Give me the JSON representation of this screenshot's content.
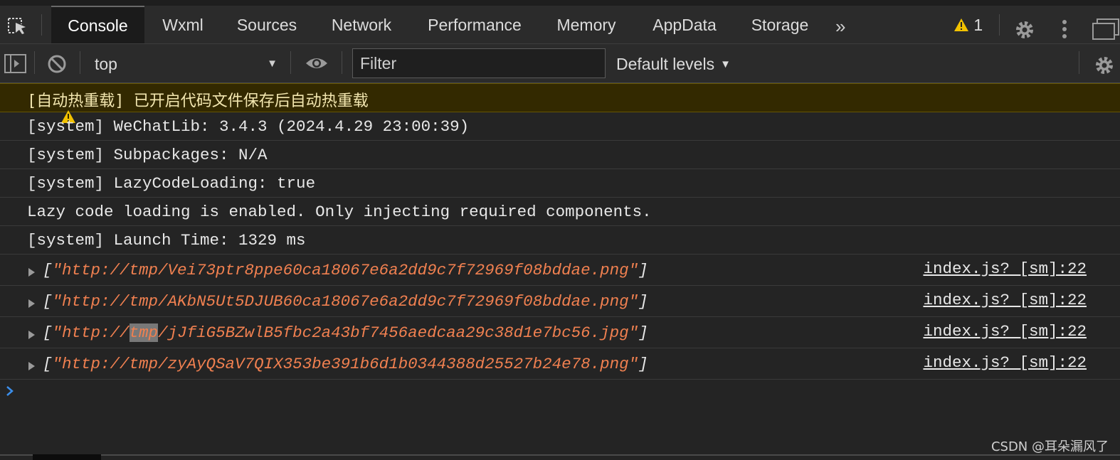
{
  "tabs": [
    {
      "label": "Console",
      "active": true
    },
    {
      "label": "Wxml"
    },
    {
      "label": "Sources"
    },
    {
      "label": "Network"
    },
    {
      "label": "Performance"
    },
    {
      "label": "Memory"
    },
    {
      "label": "AppData"
    },
    {
      "label": "Storage"
    }
  ],
  "topbar": {
    "warning_count": "1",
    "icons": [
      "inspect-element-icon",
      "more-tabs-icon",
      "warning-icon",
      "gear-icon",
      "kebab-menu-icon",
      "dock-icon"
    ]
  },
  "toolbar": {
    "context": "top",
    "filter_placeholder": "Filter",
    "levels": "Default levels",
    "icons": [
      "sidebar-toggle-icon",
      "clear-console-icon",
      "eye-icon",
      "gear-icon"
    ]
  },
  "console": {
    "warning": "[自动热重载] 已开启代码文件保存后自动热重载",
    "lines": [
      "[system] WeChatLib: 3.4.3 (2024.4.29 23:00:39)",
      "[system] Subpackages: N/A",
      "[system] LazyCodeLoading: true",
      "Lazy code loading is enabled. Only injecting required components.",
      "[system] Launch Time: 1329 ms"
    ],
    "arrays": [
      {
        "value": "\"http://tmp/Vei73ptr8ppe60ca18067e6a2dd9c7f72969f08bddae.png\"",
        "source": "index.js? [sm]:22"
      },
      {
        "value": "\"http://tmp/AKbN5Ut5DJUB60ca18067e6a2dd9c7f72969f08bddae.png\"",
        "source": "index.js? [sm]:22"
      },
      {
        "value_prefix": "\"http://",
        "value_highlight": "tmp",
        "value_suffix": "/jJfiG5BZwlB5fbc2a43bf7456aedcaa29c38d1e7bc56.jpg\"",
        "source": "index.js? [sm]:22"
      },
      {
        "value": "\"http://tmp/zyAyQSaV7QIX353be391b6d1b0344388d25527b24e78.png\"",
        "source": "index.js? [sm]:22"
      }
    ],
    "bracket_open": "[",
    "bracket_close": "]"
  },
  "watermark": "CSDN @耳朵漏风了",
  "colors": {
    "background": "#242424",
    "warning_bg": "#332900",
    "string": "#f08050",
    "prompt": "#3b8eea",
    "warning_icon": "#f2c200"
  }
}
